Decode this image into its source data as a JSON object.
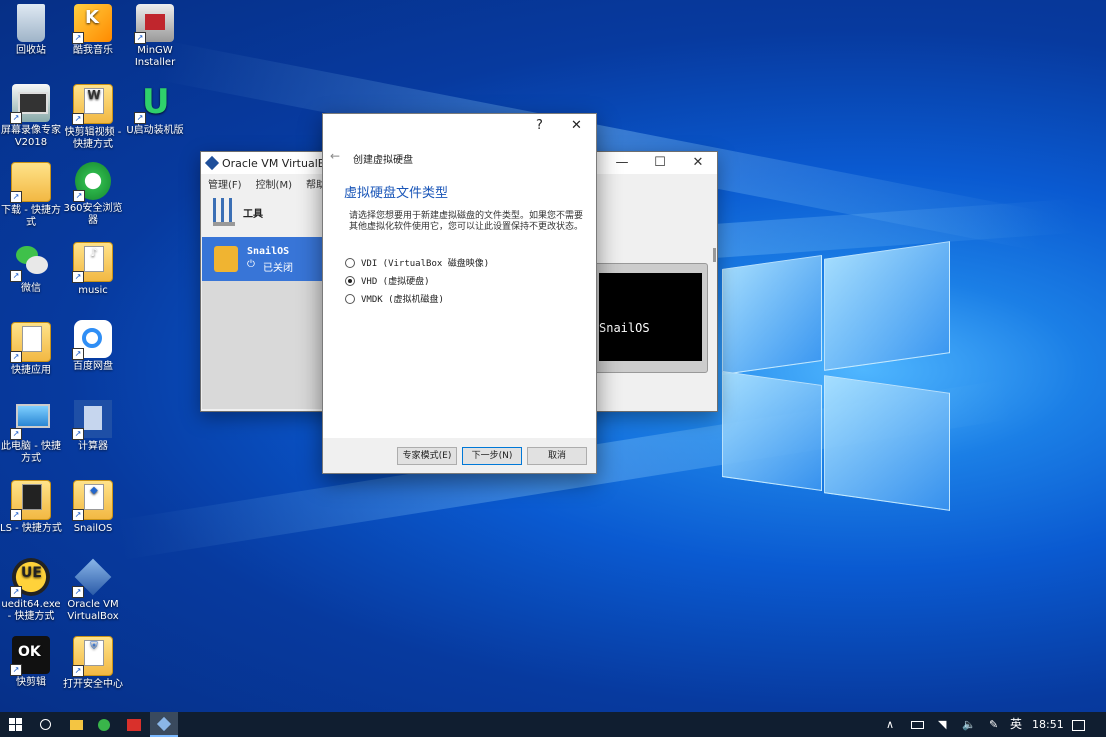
{
  "desktop": {
    "icons": [
      {
        "label": "回收站"
      },
      {
        "label": "酷我音乐"
      },
      {
        "label": "MinGW Installer"
      },
      {
        "label": "屏幕录像专家V2018"
      },
      {
        "label": "快剪辑视频 - 快捷方式"
      },
      {
        "label": "U启动装机版"
      },
      {
        "label": "下载 - 快捷方式"
      },
      {
        "label": "360安全浏览器"
      },
      {
        "label": "微信"
      },
      {
        "label": "music"
      },
      {
        "label": "快捷应用"
      },
      {
        "label": "百度网盘"
      },
      {
        "label": "此电脑 - 快捷方式"
      },
      {
        "label": "计算器"
      },
      {
        "label": "LS - 快捷方式"
      },
      {
        "label": "SnailOS"
      },
      {
        "label": "uedit64.exe - 快捷方式"
      },
      {
        "label": "Oracle VM VirtualBox"
      },
      {
        "label": "快剪辑"
      },
      {
        "label": "打开安全中心"
      }
    ]
  },
  "vbox": {
    "title": "Oracle VM VirtualBox",
    "menu": [
      "管理(F)",
      "控制(M)",
      "帮助"
    ],
    "tools_label": "工具",
    "vm": {
      "name": "SnailOS",
      "state": "已关闭"
    },
    "preview_text": "SnailOS",
    "controls": {
      "minimize": "—",
      "maximize": "☐",
      "close": "✕"
    }
  },
  "wizard": {
    "help": "?",
    "close": "✕",
    "back": "←",
    "title": "创建虚拟硬盘",
    "heading": "虚拟硬盘文件类型",
    "description": "请选择您想要用于新建虚拟磁盘的文件类型。如果您不需要其他虚拟化软件使用它，您可以让此设置保持不更改状态。",
    "options": [
      {
        "label": "VDI (VirtualBox 磁盘映像)",
        "selected": false
      },
      {
        "label": "VHD (虚拟硬盘)",
        "selected": true
      },
      {
        "label": "VMDK (虚拟机磁盘)",
        "selected": false
      }
    ],
    "buttons": {
      "expert": "专家模式(E)",
      "next": "下一步(N)",
      "cancel": "取消"
    }
  },
  "taskbar": {
    "time": "18:51",
    "ime": "英",
    "tray_up": "∧"
  }
}
